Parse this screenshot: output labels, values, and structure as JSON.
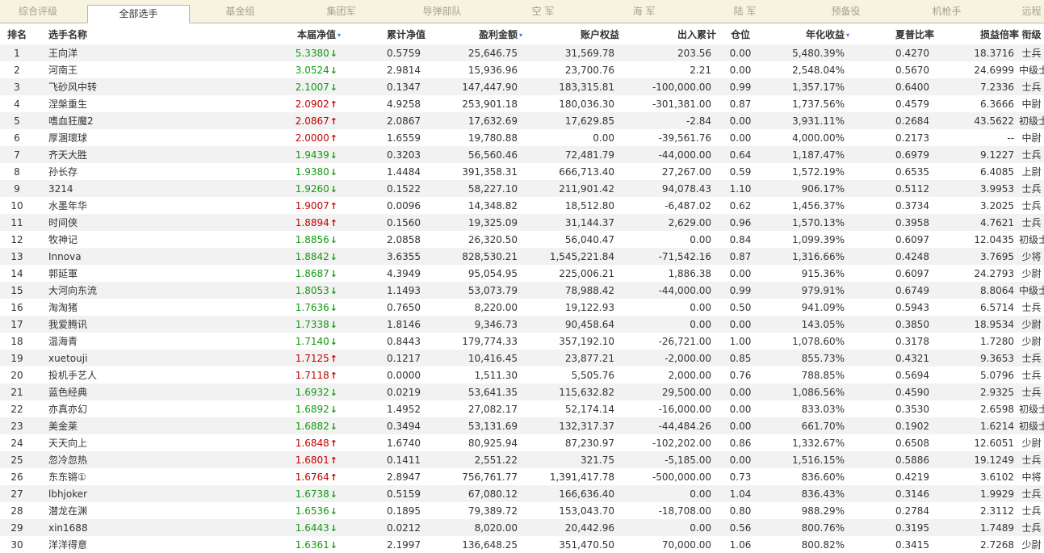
{
  "tabs": [
    "综合评级",
    "全部选手",
    "基金组",
    "集团军",
    "导弹部队",
    "空 军",
    "海 军",
    "陆 军",
    "预备役",
    "机枪手",
    "远程"
  ],
  "active_tab": 1,
  "colors": {
    "up": "#c40000",
    "down": "#129a12",
    "sort": "#3a7bd5"
  },
  "columns": [
    {
      "key": "rank",
      "label": "排名"
    },
    {
      "key": "name",
      "label": "选手名称"
    },
    {
      "key": "nav",
      "label": "本届净值",
      "sort": "▾"
    },
    {
      "key": "acc",
      "label": "累计净值"
    },
    {
      "key": "profit",
      "label": "盈利金额",
      "sort": "▾"
    },
    {
      "key": "equity",
      "label": "账户权益"
    },
    {
      "key": "flow",
      "label": "出入累计"
    },
    {
      "key": "pos",
      "label": "仓位"
    },
    {
      "key": "annual",
      "label": "年化收益",
      "sort": "▾"
    },
    {
      "key": "sharpe",
      "label": "夏普比率"
    },
    {
      "key": "pl",
      "label": "损益倍率"
    },
    {
      "key": "title",
      "label": "衔级"
    }
  ],
  "rows": [
    {
      "rank": "1",
      "name": "王向洋",
      "nav": "5.3380",
      "dir": "down",
      "acc": "0.5759",
      "profit": "25,646.75",
      "equity": "31,569.78",
      "flow": "203.56",
      "pos": "0.00",
      "annual": "5,480.39%",
      "sharpe": "0.4270",
      "pl": "18.3716",
      "title": "士兵"
    },
    {
      "rank": "2",
      "name": "河南王",
      "nav": "3.0524",
      "dir": "down",
      "acc": "2.9814",
      "profit": "15,936.96",
      "equity": "23,700.76",
      "flow": "2.21",
      "pos": "0.00",
      "annual": "2,548.04%",
      "sharpe": "0.5670",
      "pl": "24.6999",
      "title": "中级士官"
    },
    {
      "rank": "3",
      "name": "飞砂风中转",
      "nav": "2.1007",
      "dir": "down",
      "acc": "0.1347",
      "profit": "147,447.90",
      "equity": "183,315.81",
      "flow": "-100,000.00",
      "pos": "0.99",
      "annual": "1,357.17%",
      "sharpe": "0.6400",
      "pl": "7.2336",
      "title": "士兵"
    },
    {
      "rank": "4",
      "name": "涅槃重生",
      "nav": "2.0902",
      "dir": "up",
      "acc": "4.9258",
      "profit": "253,901.18",
      "equity": "180,036.30",
      "flow": "-301,381.00",
      "pos": "0.87",
      "annual": "1,737.56%",
      "sharpe": "0.4579",
      "pl": "6.3666",
      "title": "中尉"
    },
    {
      "rank": "5",
      "name": "嗜血狂魔2",
      "nav": "2.0867",
      "dir": "up",
      "acc": "2.0867",
      "profit": "17,632.69",
      "equity": "17,629.85",
      "flow": "-2.84",
      "pos": "0.00",
      "annual": "3,931.11%",
      "sharpe": "0.2684",
      "pl": "43.5622",
      "title": "初级士官"
    },
    {
      "rank": "6",
      "name": "厚溷瓌球",
      "nav": "2.0000",
      "dir": "up",
      "acc": "1.6559",
      "profit": "19,780.88",
      "equity": "0.00",
      "flow": "-39,561.76",
      "pos": "0.00",
      "annual": "4,000.00%",
      "sharpe": "0.2173",
      "pl": "--",
      "title": "中尉"
    },
    {
      "rank": "7",
      "name": "齐天大胜",
      "nav": "1.9439",
      "dir": "down",
      "acc": "0.3203",
      "profit": "56,560.46",
      "equity": "72,481.79",
      "flow": "-44,000.00",
      "pos": "0.64",
      "annual": "1,187.47%",
      "sharpe": "0.6979",
      "pl": "9.1227",
      "title": "士兵"
    },
    {
      "rank": "8",
      "name": "孙长存",
      "nav": "1.9380",
      "dir": "down",
      "acc": "1.4484",
      "profit": "391,358.31",
      "equity": "666,713.40",
      "flow": "27,267.00",
      "pos": "0.59",
      "annual": "1,572.19%",
      "sharpe": "0.6535",
      "pl": "6.4085",
      "title": "上尉"
    },
    {
      "rank": "9",
      "name": "3214",
      "nav": "1.9260",
      "dir": "down",
      "acc": "0.1522",
      "profit": "58,227.10",
      "equity": "211,901.42",
      "flow": "94,078.43",
      "pos": "1.10",
      "annual": "906.17%",
      "sharpe": "0.5112",
      "pl": "3.9953",
      "title": "士兵"
    },
    {
      "rank": "10",
      "name": "水墨年华",
      "nav": "1.9007",
      "dir": "up",
      "acc": "0.0096",
      "profit": "14,348.82",
      "equity": "18,512.80",
      "flow": "-6,487.02",
      "pos": "0.62",
      "annual": "1,456.37%",
      "sharpe": "0.3734",
      "pl": "3.2025",
      "title": "士兵"
    },
    {
      "rank": "11",
      "name": "时间侠",
      "nav": "1.8894",
      "dir": "up",
      "acc": "0.1560",
      "profit": "19,325.09",
      "equity": "31,144.37",
      "flow": "2,629.00",
      "pos": "0.96",
      "annual": "1,570.13%",
      "sharpe": "0.3958",
      "pl": "4.7621",
      "title": "士兵"
    },
    {
      "rank": "12",
      "name": "牧神记",
      "nav": "1.8856",
      "dir": "down",
      "acc": "2.0858",
      "profit": "26,320.50",
      "equity": "56,040.47",
      "flow": "0.00",
      "pos": "0.84",
      "annual": "1,099.39%",
      "sharpe": "0.6097",
      "pl": "12.0435",
      "title": "初级士官"
    },
    {
      "rank": "13",
      "name": "Innova",
      "nav": "1.8842",
      "dir": "down",
      "acc": "3.6355",
      "profit": "828,530.21",
      "equity": "1,545,221.84",
      "flow": "-71,542.16",
      "pos": "0.87",
      "annual": "1,316.66%",
      "sharpe": "0.4248",
      "pl": "3.7695",
      "title": "少将"
    },
    {
      "rank": "14",
      "name": "郭延軍",
      "nav": "1.8687",
      "dir": "down",
      "acc": "4.3949",
      "profit": "95,054.95",
      "equity": "225,006.21",
      "flow": "1,886.38",
      "pos": "0.00",
      "annual": "915.36%",
      "sharpe": "0.6097",
      "pl": "24.2793",
      "title": "少尉"
    },
    {
      "rank": "15",
      "name": "大河向东流",
      "nav": "1.8053",
      "dir": "down",
      "acc": "1.1493",
      "profit": "53,073.79",
      "equity": "78,988.42",
      "flow": "-44,000.00",
      "pos": "0.99",
      "annual": "979.91%",
      "sharpe": "0.6749",
      "pl": "8.8064",
      "title": "中级士官"
    },
    {
      "rank": "16",
      "name": "淘淘猪",
      "nav": "1.7636",
      "dir": "down",
      "acc": "0.7650",
      "profit": "8,220.00",
      "equity": "19,122.93",
      "flow": "0.00",
      "pos": "0.50",
      "annual": "941.09%",
      "sharpe": "0.5943",
      "pl": "6.5714",
      "title": "士兵"
    },
    {
      "rank": "17",
      "name": "我爱腾讯",
      "nav": "1.7338",
      "dir": "down",
      "acc": "1.8146",
      "profit": "9,346.73",
      "equity": "90,458.64",
      "flow": "0.00",
      "pos": "0.00",
      "annual": "143.05%",
      "sharpe": "0.3850",
      "pl": "18.9534",
      "title": "少尉"
    },
    {
      "rank": "18",
      "name": "温海青",
      "nav": "1.7140",
      "dir": "down",
      "acc": "0.8443",
      "profit": "179,774.33",
      "equity": "357,192.10",
      "flow": "-26,721.00",
      "pos": "1.00",
      "annual": "1,078.60%",
      "sharpe": "0.3178",
      "pl": "1.7280",
      "title": "少尉"
    },
    {
      "rank": "19",
      "name": "xuetouji",
      "nav": "1.7125",
      "dir": "up",
      "acc": "0.1217",
      "profit": "10,416.45",
      "equity": "23,877.21",
      "flow": "-2,000.00",
      "pos": "0.85",
      "annual": "855.73%",
      "sharpe": "0.4321",
      "pl": "9.3653",
      "title": "士兵"
    },
    {
      "rank": "20",
      "name": "投机手艺人",
      "nav": "1.7118",
      "dir": "up",
      "acc": "0.0000",
      "profit": "1,511.30",
      "equity": "5,505.76",
      "flow": "2,000.00",
      "pos": "0.76",
      "annual": "788.85%",
      "sharpe": "0.5694",
      "pl": "5.0796",
      "title": "士兵"
    },
    {
      "rank": "21",
      "name": "蓝色经典",
      "nav": "1.6932",
      "dir": "down",
      "acc": "0.0219",
      "profit": "53,641.35",
      "equity": "115,632.82",
      "flow": "29,500.00",
      "pos": "0.00",
      "annual": "1,086.56%",
      "sharpe": "0.4590",
      "pl": "2.9325",
      "title": "士兵"
    },
    {
      "rank": "22",
      "name": "亦真亦幻",
      "nav": "1.6892",
      "dir": "down",
      "acc": "1.4952",
      "profit": "27,082.17",
      "equity": "52,174.14",
      "flow": "-16,000.00",
      "pos": "0.00",
      "annual": "833.03%",
      "sharpe": "0.3530",
      "pl": "2.6598",
      "title": "初级士官"
    },
    {
      "rank": "23",
      "name": "美金莱",
      "nav": "1.6882",
      "dir": "down",
      "acc": "0.3494",
      "profit": "53,131.69",
      "equity": "132,317.37",
      "flow": "-44,484.26",
      "pos": "0.00",
      "annual": "661.70%",
      "sharpe": "0.1902",
      "pl": "1.6214",
      "title": "初级士官"
    },
    {
      "rank": "24",
      "name": "天天向上",
      "nav": "1.6848",
      "dir": "up",
      "acc": "1.6740",
      "profit": "80,925.94",
      "equity": "87,230.97",
      "flow": "-102,202.00",
      "pos": "0.86",
      "annual": "1,332.67%",
      "sharpe": "0.6508",
      "pl": "12.6051",
      "title": "少尉"
    },
    {
      "rank": "25",
      "name": "忽冷忽热",
      "nav": "1.6801",
      "dir": "up",
      "acc": "0.1411",
      "profit": "2,551.22",
      "equity": "321.75",
      "flow": "-5,185.00",
      "pos": "0.00",
      "annual": "1,516.15%",
      "sharpe": "0.5886",
      "pl": "19.1249",
      "title": "士兵"
    },
    {
      "rank": "26",
      "name": "东东锵①",
      "nav": "1.6764",
      "dir": "up",
      "acc": "2.8947",
      "profit": "756,761.77",
      "equity": "1,391,417.78",
      "flow": "-500,000.00",
      "pos": "0.73",
      "annual": "836.60%",
      "sharpe": "0.4219",
      "pl": "3.6102",
      "title": "中将"
    },
    {
      "rank": "27",
      "name": "lbhjoker",
      "nav": "1.6738",
      "dir": "down",
      "acc": "0.5159",
      "profit": "67,080.12",
      "equity": "166,636.40",
      "flow": "0.00",
      "pos": "1.04",
      "annual": "836.43%",
      "sharpe": "0.3146",
      "pl": "1.9929",
      "title": "士兵"
    },
    {
      "rank": "28",
      "name": "潜龙在渊",
      "nav": "1.6536",
      "dir": "down",
      "acc": "0.1895",
      "profit": "79,389.72",
      "equity": "153,043.70",
      "flow": "-18,708.00",
      "pos": "0.80",
      "annual": "988.29%",
      "sharpe": "0.2784",
      "pl": "2.3112",
      "title": "士兵"
    },
    {
      "rank": "29",
      "name": "xin1688",
      "nav": "1.6443",
      "dir": "down",
      "acc": "0.0212",
      "profit": "8,020.00",
      "equity": "20,442.96",
      "flow": "0.00",
      "pos": "0.56",
      "annual": "800.76%",
      "sharpe": "0.3195",
      "pl": "1.7489",
      "title": "士兵"
    },
    {
      "rank": "30",
      "name": "洋洋得意",
      "nav": "1.6361",
      "dir": "down",
      "acc": "2.1997",
      "profit": "136,648.25",
      "equity": "351,470.50",
      "flow": "70,000.00",
      "pos": "1.06",
      "annual": "800.82%",
      "sharpe": "0.3415",
      "pl": "2.7268",
      "title": "少尉"
    }
  ]
}
